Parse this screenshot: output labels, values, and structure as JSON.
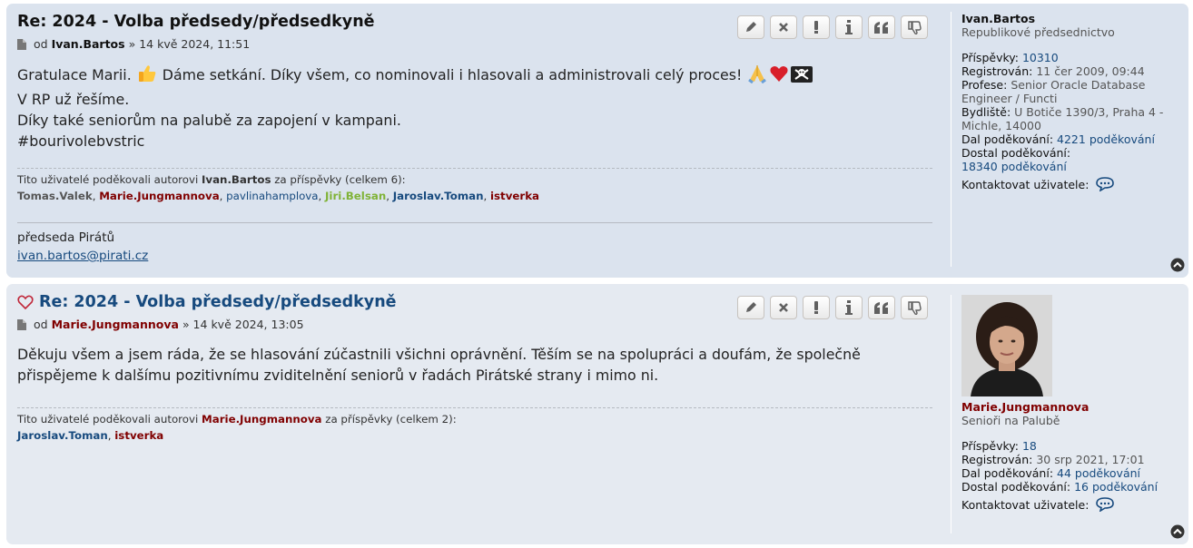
{
  "posts": [
    {
      "title": "Re: 2024 - Volba předsedy/předsedkyně",
      "meta_prefix": "od",
      "author": "Ivan.Bartos",
      "meta_date": "» 14 kvě 2024, 11:51",
      "content_lines": [
        "Gratulace Marii.",
        "Dáme setkání. Díky všem, co nominovali i hlasovali a administrovali celý proces!",
        "V RP už řešíme.",
        "Díky také seniorům na palubě za zapojení v kampani.",
        "#bourivolebvstric"
      ],
      "thanks_intro": "Tito uživatelé poděkovali autorovi",
      "thanks_author": "Ivan.Bartos",
      "thanks_suffix": "za příspěvky (celkem 6):",
      "thanks_users": [
        "Tomas.Valek",
        "Marie.Jungmannova",
        "pavlinahamplova",
        "Jiri.Belsan",
        "Jaroslav.Toman",
        "istverka"
      ],
      "signature_line": "předseda Pirátů",
      "signature_email": "ivan.bartos@pirati.cz",
      "profile": {
        "username": "Ivan.Bartos",
        "rank": "Republikové předsednictvo",
        "posts_label": "Příspěvky:",
        "posts_value": "10310",
        "registered_label": "Registrován:",
        "registered_value": "11 čer 2009, 09:44",
        "profession_label": "Profese:",
        "profession_value": "Senior Oracle Database Engineer / Functi",
        "residence_label": "Bydliště:",
        "residence_value": "U Botiče 1390/3, Praha 4 - Michle, 14000",
        "gave_label": "Dal poděkování:",
        "gave_value": "4221 poděkování",
        "got_label": "Dostal poděkování:",
        "got_value": "18340 poděkování",
        "contact_label": "Kontaktovat uživatele:"
      }
    },
    {
      "title": "Re: 2024 - Volba předsedy/předsedkyně",
      "meta_prefix": "od",
      "author": "Marie.Jungmannova",
      "meta_date": "» 14 kvě 2024, 13:05",
      "content_lines": [
        "Děkuju všem a jsem ráda, že se hlasování zúčastnili všichni oprávnění. Těším se na spolupráci a doufám, že společně",
        "přispějeme k dalšímu pozitivnímu zviditelnění seniorů v řadách Pirátské strany i mimo ni."
      ],
      "thanks_intro": "Tito uživatelé poděkovali autorovi",
      "thanks_author": "Marie.Jungmannova",
      "thanks_suffix": "za příspěvky (celkem 2):",
      "thanks_users": [
        "Jaroslav.Toman",
        "istverka"
      ],
      "profile": {
        "username": "Marie.Jungmannova",
        "rank": "Senioři na Palubě",
        "posts_label": "Příspěvky:",
        "posts_value": "18",
        "registered_label": "Registrován:",
        "registered_value": "30 srp 2021, 17:01",
        "gave_label": "Dal poděkování:",
        "gave_value": "44 poděkování",
        "got_label": "Dostal poděkování:",
        "got_value": "16 poděkování",
        "contact_label": "Kontaktovat uživatele:"
      }
    }
  ],
  "buttons": [
    "edit",
    "delete",
    "report",
    "info",
    "quote",
    "dislike"
  ],
  "colors": {
    "post1_bg": "#dbe3ee",
    "post2_bg": "#e5eaf1",
    "link": "#174a7e",
    "author_red": "#800000",
    "green_user": "#80b337"
  }
}
